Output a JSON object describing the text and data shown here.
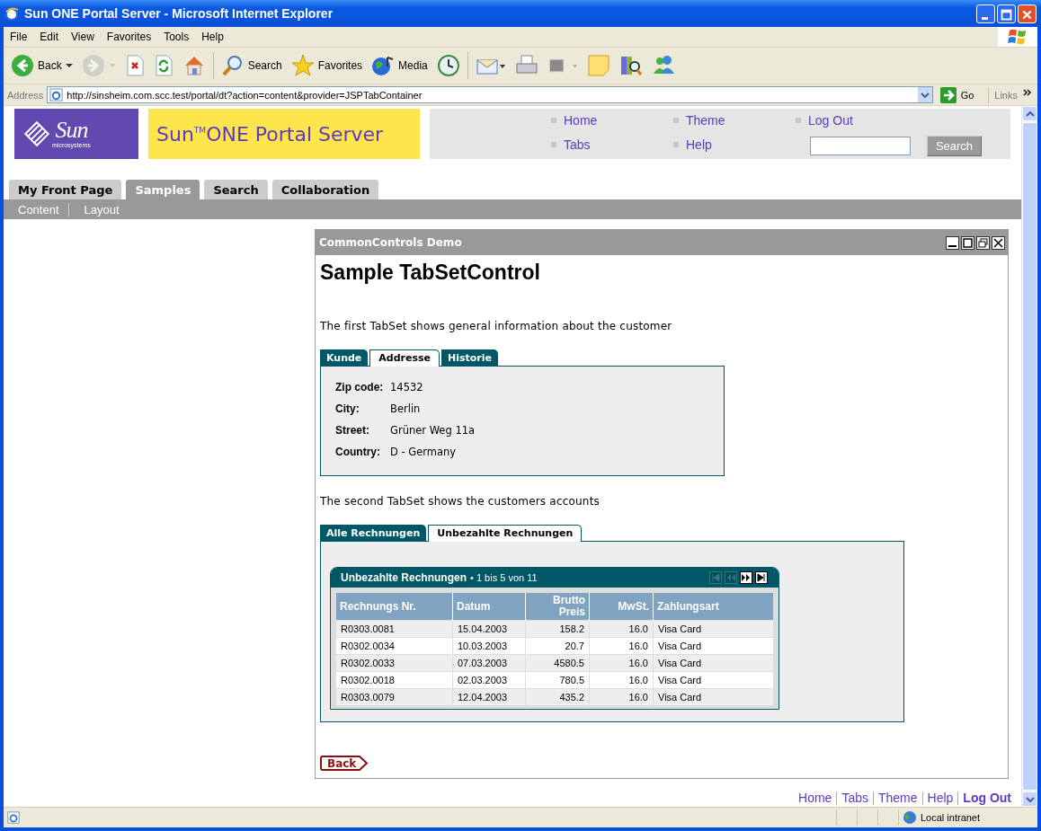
{
  "window": {
    "title": "Sun ONE Portal Server - Microsoft Internet Explorer"
  },
  "menu": [
    "File",
    "Edit",
    "View",
    "Favorites",
    "Tools",
    "Help"
  ],
  "toolbar": [
    {
      "kind": "back",
      "label": "Back",
      "disabled": false
    },
    {
      "kind": "forward",
      "disabled": true
    },
    {
      "kind": "stop",
      "disabled": false
    },
    {
      "kind": "refresh",
      "disabled": false
    },
    {
      "kind": "home",
      "disabled": false
    },
    {
      "kind": "search",
      "label": "Search",
      "disabled": false
    },
    {
      "kind": "favorites",
      "label": "Favorites",
      "disabled": false
    },
    {
      "kind": "media",
      "label": "Media",
      "disabled": false
    },
    {
      "kind": "history",
      "disabled": false
    },
    {
      "kind": "mail",
      "disabled": false
    },
    {
      "kind": "print",
      "disabled": false
    },
    {
      "kind": "edit",
      "disabled": false
    },
    {
      "kind": "note",
      "disabled": false
    },
    {
      "kind": "research",
      "disabled": false
    },
    {
      "kind": "messenger",
      "disabled": false
    }
  ],
  "address": {
    "label": "Address",
    "url": "http://sinsheim.com.scc.test/portal/dt?action=content&provider=JSPTabContainer",
    "go": "Go",
    "links": "Links"
  },
  "portal": {
    "logo": "Sun",
    "logo_sub": "microsystems",
    "banner": "Sun$^{TM}$ONE Portal Server",
    "nav": [
      [
        "Home",
        "Tabs"
      ],
      [
        "Theme",
        "Help"
      ],
      [
        "Log Out"
      ]
    ],
    "search_button": "Search"
  },
  "tabs": [
    {
      "label": "My Front Page",
      "selected": false
    },
    {
      "label": "Samples",
      "selected": true
    },
    {
      "label": "Search",
      "selected": false
    },
    {
      "label": "Collaboration",
      "selected": false
    }
  ],
  "subtabs": [
    "Content",
    "Layout"
  ],
  "portlet": {
    "title": "CommonControls Demo",
    "heading": "Sample TabSetControl",
    "intro1": "The first TabSet shows general information about the customer",
    "tabset1": {
      "tabs": [
        {
          "label": "Kunde",
          "selected": false
        },
        {
          "label": "Addresse",
          "selected": true
        },
        {
          "label": "Historie",
          "selected": false
        }
      ],
      "fields": [
        {
          "label": "Zip code:",
          "value": "14532"
        },
        {
          "label": "City:",
          "value": "Berlin"
        },
        {
          "label": "Street:",
          "value": "Grüner Weg 11a"
        },
        {
          "label": "Country:",
          "value": "D - Germany"
        }
      ]
    },
    "intro2": "The second TabSet shows the customers accounts",
    "tabset2": {
      "tabs": [
        {
          "label": "Alle Rechnungen",
          "selected": false
        },
        {
          "label": "Unbezahlte Rechnungen",
          "selected": true
        }
      ],
      "table": {
        "title": "Unbezahlte Rechnungen",
        "range": "• 1 bis 5 von 11",
        "pager": [
          {
            "kind": "first",
            "disabled": true
          },
          {
            "kind": "prev",
            "disabled": true
          },
          {
            "kind": "next",
            "disabled": false
          },
          {
            "kind": "last",
            "disabled": false
          }
        ],
        "columns": [
          {
            "label": "Rechnungs Nr.",
            "numeric": false
          },
          {
            "label": "Datum",
            "numeric": false
          },
          {
            "label": "Brutto Preis",
            "numeric": true
          },
          {
            "label": "MwSt.",
            "numeric": true
          },
          {
            "label": "Zahlungsart",
            "numeric": false
          }
        ],
        "rows": [
          [
            "R0303.0081",
            "15.04.2003",
            "158.2",
            "16.0",
            "Visa Card"
          ],
          [
            "R0302.0034",
            "10.03.2003",
            "20.7",
            "16.0",
            "Visa Card"
          ],
          [
            "R0302.0033",
            "07.03.2003",
            "4580.5",
            "16.0",
            "Visa Card"
          ],
          [
            "R0302.0018",
            "02.03.2003",
            "780.5",
            "16.0",
            "Visa Card"
          ],
          [
            "R0303.0079",
            "12.04.2003",
            "435.2",
            "16.0",
            "Visa Card"
          ]
        ]
      }
    },
    "back": "Back"
  },
  "footer_links": [
    {
      "label": "Home",
      "bold": false
    },
    {
      "label": "Tabs",
      "bold": false
    },
    {
      "label": "Theme",
      "bold": false
    },
    {
      "label": "Help",
      "bold": false
    },
    {
      "label": "Log Out",
      "bold": true
    }
  ],
  "status_bar": {
    "zone": "Local intranet"
  }
}
